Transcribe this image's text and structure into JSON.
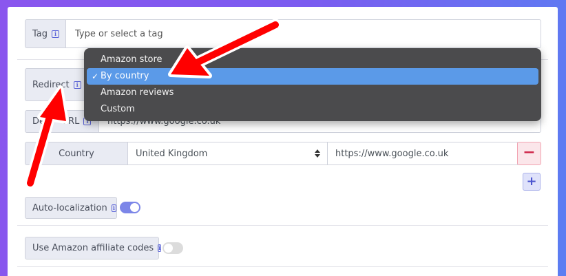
{
  "form": {
    "tag": {
      "label": "Tag",
      "placeholder": "Type or select a tag"
    },
    "redirect": {
      "label": "Redirect",
      "options": [
        {
          "label": "Amazon store",
          "selected": false
        },
        {
          "label": "By country",
          "selected": true
        },
        {
          "label": "Amazon reviews",
          "selected": false
        },
        {
          "label": "Custom",
          "selected": false
        }
      ]
    },
    "default_url": {
      "label_start": "Def",
      "label_end": "URL",
      "value": "https://www.google.co.uk"
    },
    "country_row": {
      "label": "Country",
      "selected_country": "United Kingdom",
      "url": "https://www.google.co.uk",
      "remove_symbol": "−",
      "add_symbol": "+"
    },
    "auto_localization": {
      "label": "Auto-localization",
      "enabled": true
    },
    "affiliate_codes": {
      "label": "Use Amazon affiliate codes",
      "enabled": false
    }
  },
  "icons": {
    "info": "info-icon",
    "checkmark": "✓"
  },
  "colors": {
    "accent": "#5a63d8",
    "selected_option": "#5b9ae8",
    "toggle_on": "#7c86e8",
    "remove_button": "#d0294d",
    "annotation_arrow": "#ff0000"
  }
}
